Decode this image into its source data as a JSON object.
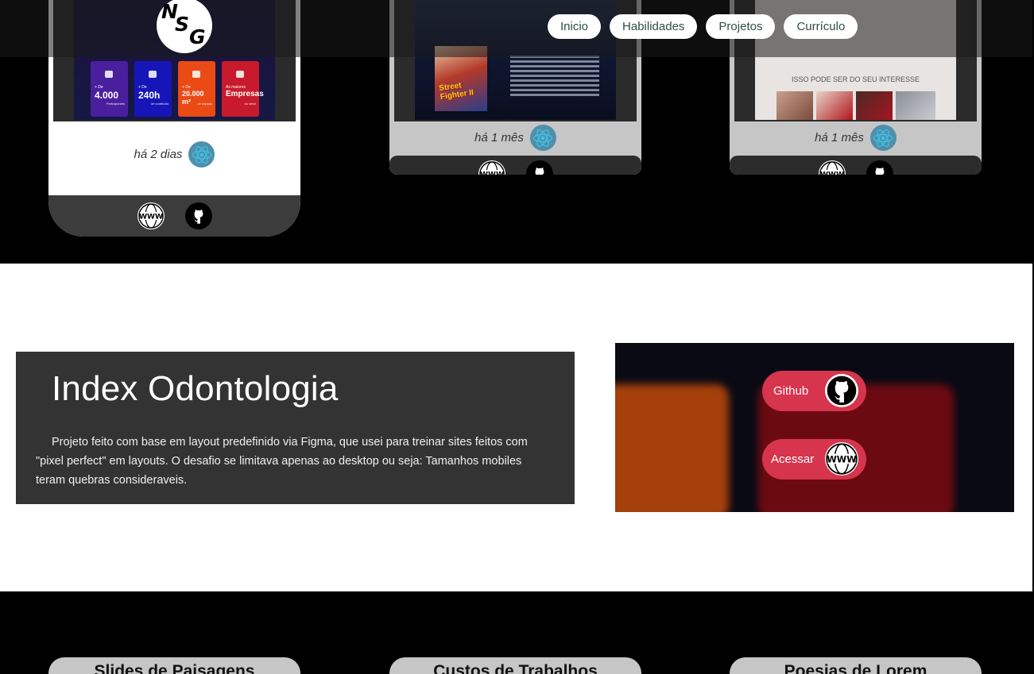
{
  "nav": {
    "logo_text": "NSG",
    "links": [
      "Inicio",
      "Habilidades",
      "Projetos",
      "Currículo"
    ]
  },
  "cards": [
    {
      "date": "há 2 dias",
      "stats": [
        {
          "prefix": "+ De",
          "value": "4.000",
          "label": "Participantes",
          "color": "#4a1f9e"
        },
        {
          "prefix": "+ De",
          "value": "240h",
          "label": "de conteúdo",
          "color": "#1616b8"
        },
        {
          "prefix": "+ De",
          "value": "20.000 m²",
          "label": "de espaço",
          "color": "#ea4a14"
        },
        {
          "prefix": "As maiores",
          "value": "Empresas",
          "label": "do setor",
          "color": "#c81a2c"
        }
      ]
    },
    {
      "date": "há 1 mês",
      "poster_text": "Street Fighter II"
    },
    {
      "date": "há 1 mês",
      "caption": "ISSO PODE SER DO SEU INTERESSE"
    }
  ],
  "project": {
    "title": "Index Odontologia",
    "description": "Projeto feito com base em layout predefinido via Figma, que usei para treinar sites feitos com \"pixel perfect\" em layouts. O desafio se limitava apenas ao desktop ou seja: Tamanhos mobiles teram quebras consideraveis.",
    "github_label": "Github",
    "access_label": "Acessar"
  },
  "bottom_cards": [
    "Slides de Paisagens",
    "Custos de Trabalhos",
    "Poesias de Lorem"
  ],
  "colors": {
    "accent": "#d7344d",
    "nav_text": "#2f4e46",
    "panel": "#333333"
  },
  "icons": [
    "www-globe-icon",
    "github-icon",
    "react-icon"
  ]
}
